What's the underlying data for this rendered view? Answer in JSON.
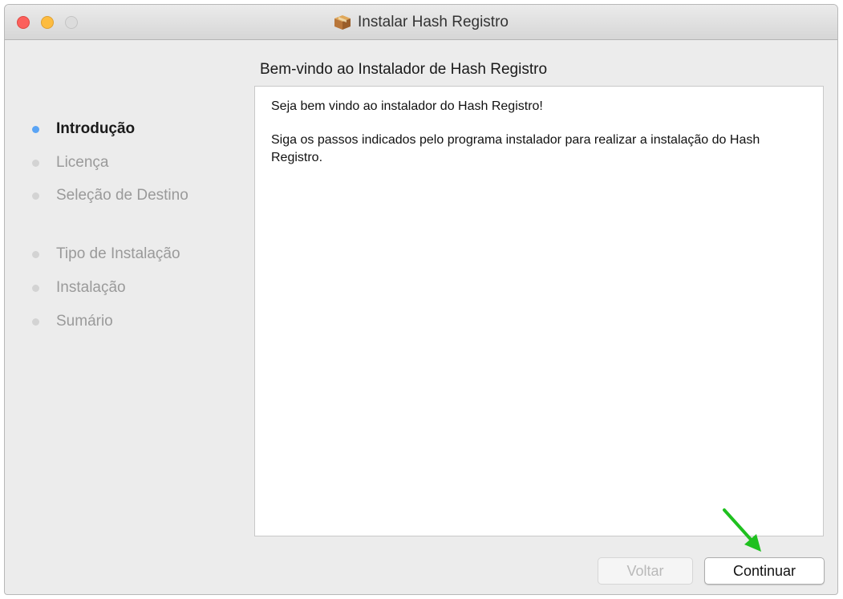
{
  "window": {
    "title": "Instalar Hash Registro"
  },
  "sidebar": {
    "steps": [
      {
        "label": "Introdução",
        "active": true
      },
      {
        "label": "Licença",
        "active": false
      },
      {
        "label": "Seleção de Destino",
        "active": false
      },
      {
        "label": "Tipo de Instalação",
        "active": false
      },
      {
        "label": "Instalação",
        "active": false
      },
      {
        "label": "Sumário",
        "active": false
      }
    ]
  },
  "main": {
    "heading": "Bem-vindo ao Instalador de Hash Registro",
    "paragraphs": [
      "Seja bem vindo ao instalador do Hash Registro!",
      "Siga os passos indicados pelo programa instalador para realizar a instalação do Hash Registro."
    ]
  },
  "footer": {
    "back_label": "Voltar",
    "continue_label": "Continuar"
  },
  "colors": {
    "active_dot": "#5aa4f5",
    "annotation_arrow": "#1fc01f"
  }
}
